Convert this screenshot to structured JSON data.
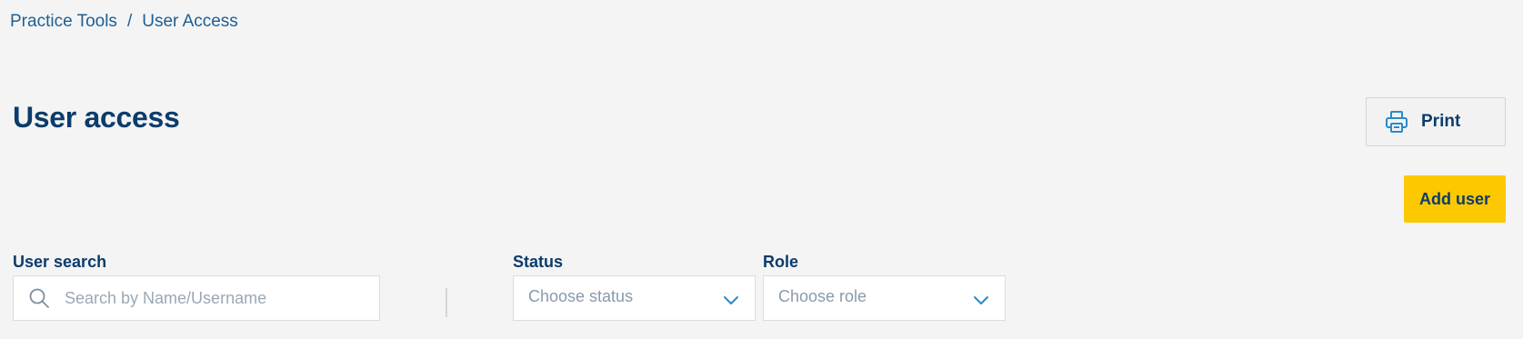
{
  "breadcrumb": {
    "items": [
      {
        "label": "Practice Tools"
      },
      {
        "label": "User Access"
      }
    ],
    "separator": "/"
  },
  "header": {
    "title": "User access",
    "print_label": "Print",
    "print_icon": "printer-icon"
  },
  "actions": {
    "add_user_label": "Add user"
  },
  "filters": {
    "search": {
      "label": "User search",
      "placeholder": "Search by Name/Username",
      "value": "",
      "icon": "search-icon"
    },
    "status": {
      "label": "Status",
      "selected": "Choose status",
      "icon": "chevron-down-icon"
    },
    "role": {
      "label": "Role",
      "selected": "Choose role",
      "icon": "chevron-down-icon"
    }
  },
  "colors": {
    "background": "#f4f4f4",
    "primary_text": "#0b3c6b",
    "link": "#1d5f94",
    "accent_button": "#fcc800",
    "icon_accent": "#2a8ac7",
    "placeholder": "#9aa8b6"
  }
}
